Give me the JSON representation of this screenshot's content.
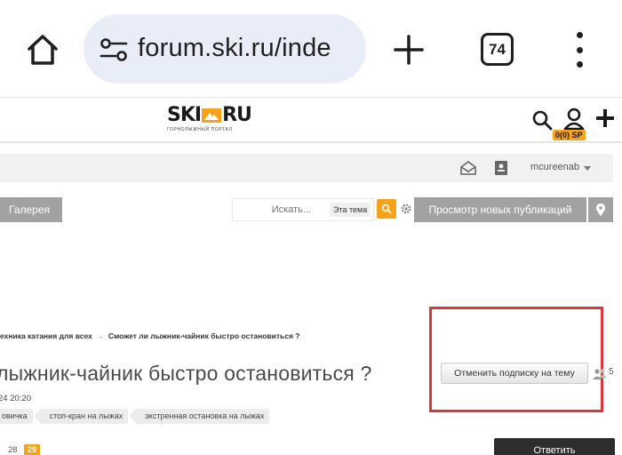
{
  "browser": {
    "url": "forum.ski.ru/inde",
    "tab_count": "74"
  },
  "header": {
    "logo_text_left": "SKI",
    "logo_text_right": "RU",
    "logo_subtitle": "ГОРНОЛЫЖНЫЙ ПОРТАЛ",
    "sp_badge": "0(0) SP"
  },
  "userbar": {
    "username": "mcureenab"
  },
  "nav": {
    "gallery": "Галерея",
    "search_placeholder": "Искать...",
    "search_scope": "Эта тема",
    "new_posts": "Просмотр новых публикаций"
  },
  "topic": {
    "breadcrumb": [
      "ехника катания для всех",
      "Сможет ли лыжник-чайник быстро остановиться ?"
    ],
    "title": "лыжник-чайник быстро остановиться ?",
    "date": "24 20:20",
    "tags": [
      "овичка",
      "стоп-кран на лыжах",
      "экстренная остановка на лыжах"
    ],
    "unsubscribe": "Отменить подписку на тему",
    "followers": "5",
    "pages": [
      "28",
      "29"
    ],
    "reply": "Ответить"
  },
  "colors": {
    "accent": "#f7a21b",
    "highlight": "#d9363e",
    "nav_gray": "#a2a2a2"
  },
  "icons": [
    "home-icon",
    "site-settings-icon",
    "plus-icon",
    "tabs-icon",
    "more-vert-icon",
    "search-icon",
    "user-icon",
    "mail-icon",
    "badge-icon",
    "gear-icon",
    "location-pin-icon",
    "followers-icon"
  ]
}
